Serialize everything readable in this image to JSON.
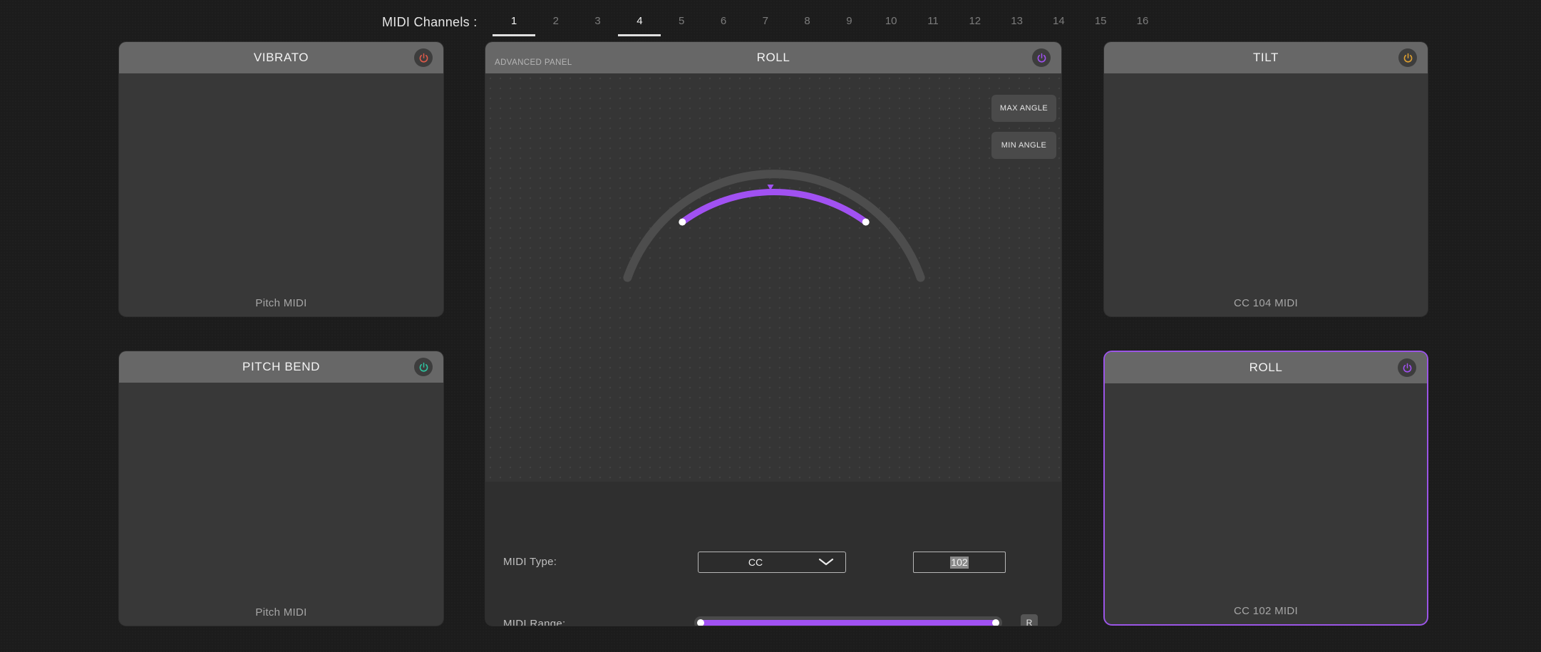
{
  "channels": {
    "label": "MIDI Channels :",
    "items": [
      "1",
      "2",
      "3",
      "4",
      "5",
      "6",
      "7",
      "8",
      "9",
      "10",
      "11",
      "12",
      "13",
      "14",
      "15",
      "16"
    ],
    "selected": [
      "1",
      "4"
    ]
  },
  "panels": {
    "vibrato": {
      "title": "VIBRATO",
      "footer": "Pitch MIDI",
      "power_color": "#e05a4a"
    },
    "pitch_bend": {
      "title": "PITCH BEND",
      "footer": "Pitch MIDI",
      "power_color": "#2ec4a0"
    },
    "tilt": {
      "title": "TILT",
      "footer": "CC 104 MIDI",
      "power_color": "#e0a030"
    },
    "roll": {
      "title": "ROLL",
      "footer": "CC 102 MIDI",
      "power_color": "#a151f2"
    }
  },
  "advanced": {
    "subtitle": "ADVANCED PANEL",
    "title": "ROLL",
    "power_color": "#a151f2",
    "max_angle_label": "MAX ANGLE",
    "min_angle_label": "MIN ANGLE",
    "midi_type_label": "MIDI Type:",
    "midi_type_value": "CC",
    "cc_number": "102",
    "midi_range_label": "MIDI Range:",
    "reset_label": "R",
    "midi_range_low": 0,
    "midi_range_high": 1
  },
  "colors": {
    "accent": "#a151f2",
    "panel_header": "#676767"
  }
}
